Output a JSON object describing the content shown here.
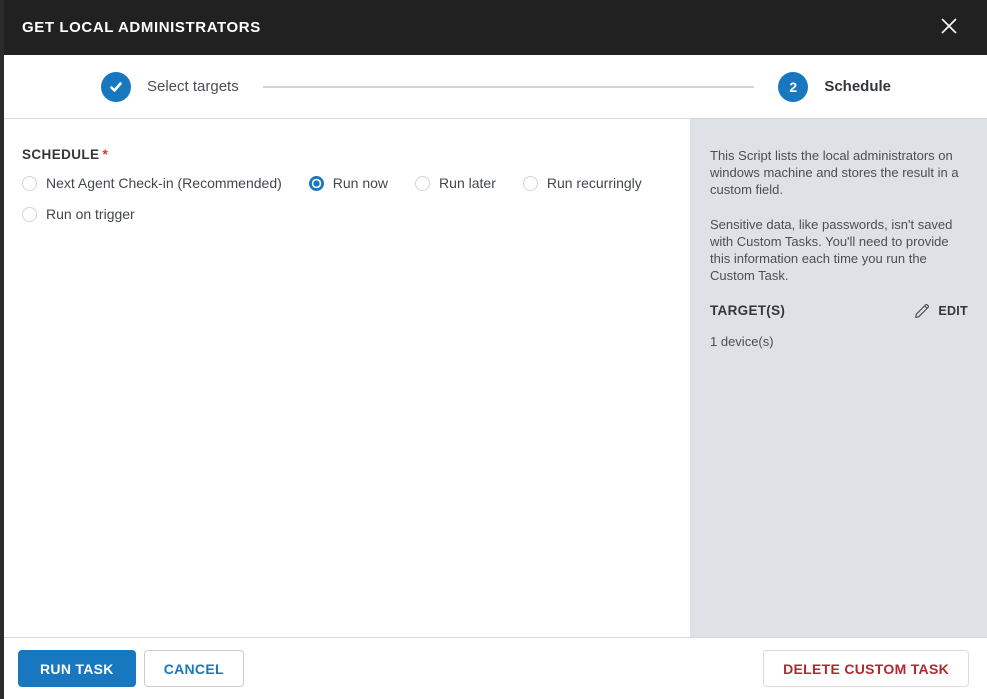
{
  "modal": {
    "title": "GET LOCAL ADMINISTRATORS"
  },
  "stepper": {
    "steps": [
      {
        "label": "Select targets",
        "state": "completed",
        "icon": "check-icon"
      },
      {
        "label": "Schedule",
        "state": "active",
        "number": "2"
      }
    ]
  },
  "schedule": {
    "label": "SCHEDULE",
    "required_marker": "*",
    "options": [
      {
        "label": "Next Agent Check-in (Recommended)",
        "selected": false
      },
      {
        "label": "Run now",
        "selected": true
      },
      {
        "label": "Run later",
        "selected": false
      },
      {
        "label": "Run recurringly",
        "selected": false
      },
      {
        "label": "Run on trigger",
        "selected": false
      }
    ]
  },
  "sidebar": {
    "description_1": "This Script lists the local administrators on windows machine and stores the result in a custom field.",
    "description_2": "Sensitive data, like passwords, isn't saved with Custom Tasks. You'll need to provide this information each time you run the Custom Task.",
    "targets_label": "TARGET(S)",
    "edit_label": "EDIT",
    "edit_icon": "pencil-icon",
    "targets_value": "1 device(s)"
  },
  "footer": {
    "run_label": "RUN TASK",
    "cancel_label": "CANCEL",
    "delete_label": "DELETE CUSTOM TASK"
  },
  "colors": {
    "accent_blue": "#1777bf",
    "header_bg": "#212121",
    "sidebar_bg": "#dee2e7",
    "delete_red": "#b02a30",
    "required_red": "#d9342b"
  }
}
